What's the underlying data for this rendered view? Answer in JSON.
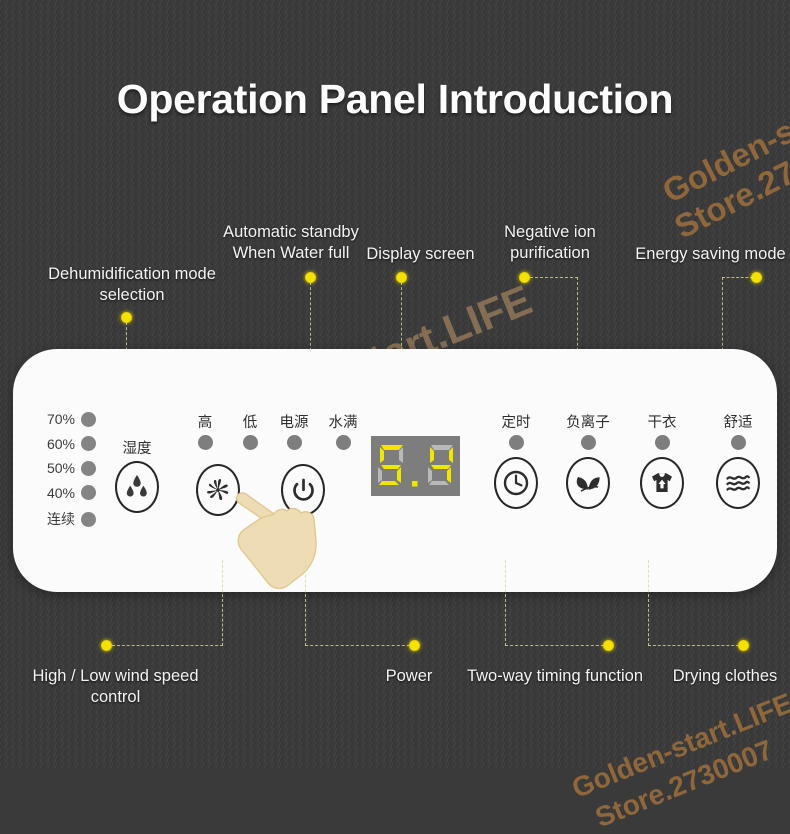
{
  "title": "Operation Panel Introduction",
  "watermark": {
    "line1": "Golden-start.LIFE",
    "line2": "Store.2730007"
  },
  "callouts": {
    "top": [
      {
        "id": "dehumidification-mode-selection",
        "label": "Dehumidification mode\nselection"
      },
      {
        "id": "automatic-standby-water-full",
        "label": "Automatic standby\nWhen Water full"
      },
      {
        "id": "display-screen",
        "label": "Display screen"
      },
      {
        "id": "negative-ion-purification",
        "label": "Negative ion\npurification"
      },
      {
        "id": "energy-saving-mode",
        "label": "Energy saving mode"
      }
    ],
    "bottom": [
      {
        "id": "wind-speed-control",
        "label": "High / Low wind speed\ncontrol"
      },
      {
        "id": "power",
        "label": "Power"
      },
      {
        "id": "two-way-timing",
        "label": "Two-way timing function"
      },
      {
        "id": "drying-clothes",
        "label": "Drying clothes"
      }
    ]
  },
  "panel": {
    "humidity_levels": [
      {
        "value": "70%"
      },
      {
        "value": "60%"
      },
      {
        "value": "50%"
      },
      {
        "value": "40%"
      },
      {
        "value": "连续"
      }
    ],
    "humidity_button": {
      "caption": "湿度",
      "icon": "water-droplets-icon"
    },
    "status_indicators": [
      {
        "caption": "高"
      },
      {
        "caption": "低"
      },
      {
        "caption": "电源"
      },
      {
        "caption": "水满"
      }
    ],
    "buttons": [
      {
        "id": "fan-speed",
        "caption": "",
        "icon": "fan-icon"
      },
      {
        "id": "power",
        "caption": "",
        "icon": "power-icon"
      },
      {
        "id": "timer",
        "caption": "定时",
        "icon": "clock-icon"
      },
      {
        "id": "negative-ion",
        "caption": "负离子",
        "icon": "leaf-icon"
      },
      {
        "id": "dry-clothes",
        "caption": "干衣",
        "icon": "tshirt-icon"
      },
      {
        "id": "comfort",
        "caption": "舒适",
        "icon": "waves-icon"
      }
    ],
    "display": {
      "value": "5.4",
      "digits": [
        "5",
        "4"
      ],
      "decimal_point": true,
      "lit_color": "#f2e500",
      "unlit_color": "#b9b9b9",
      "background": "#7d7d7d"
    }
  },
  "colors": {
    "backdrop": "#3b3b3b",
    "panel": "#fbfbfb",
    "accent_dot": "#f5e200",
    "connector": "#ded6a0",
    "title_text": "#fdfdfd",
    "hand": "#eedcb4"
  }
}
